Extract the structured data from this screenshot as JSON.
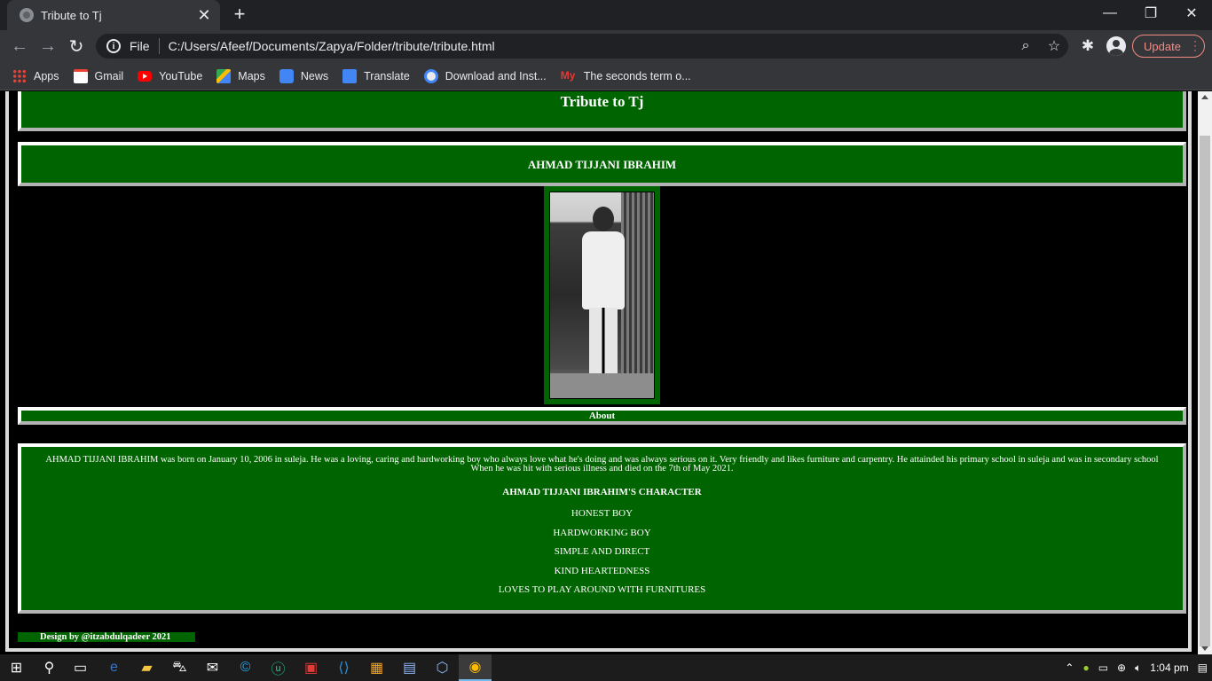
{
  "browser": {
    "tab_title": "Tribute to Tj",
    "new_tab_icon": "+",
    "close_icon": "✕",
    "window_controls": {
      "minimize": "—",
      "restore": "❐",
      "close": "✕"
    },
    "scheme_label": "File",
    "url": "C:/Users/Afeef/Documents/Zapya/Folder/tribute/tribute.html",
    "update_label": "Update"
  },
  "bookmarks": [
    {
      "label": "Apps",
      "icon": "apps-icon"
    },
    {
      "label": "Gmail",
      "icon": "gmail-icon"
    },
    {
      "label": "YouTube",
      "icon": "youtube-icon"
    },
    {
      "label": "Maps",
      "icon": "maps-icon"
    },
    {
      "label": "News",
      "icon": "news-icon"
    },
    {
      "label": "Translate",
      "icon": "translate-icon"
    },
    {
      "label": "Download and Inst...",
      "icon": "download-icon"
    },
    {
      "label": "The seconds term o...",
      "icon": "my-icon",
      "icon_text": "My"
    }
  ],
  "page": {
    "title": "Tribute to Tj",
    "name": "AHMAD TIJJANI IBRAHIM",
    "about_heading": "About",
    "bio": "AHMAD TIJJANI IBRAHIM was born on January 10, 2006 in suleja. He was a loving, caring and hardworking boy who always love what he's doing and was always serious on it. Very friendly and likes furniture and carpentry. He attainded his primary school in suleja and was in secondary school When he was hit with serious illness and died on the 7th of May 2021.",
    "character_heading": "AHMAD TIJJANI IBRAHIM'S CHARACTER",
    "traits": [
      "HONEST BOY",
      "HARDWORKING BOY",
      "SIMPLE AND DIRECT",
      "KIND HEARTEDNESS",
      "LOVES TO PLAY AROUND WITH FURNITURES"
    ],
    "footer": "Design by @itzabdulqadeer 2021"
  },
  "taskbar": {
    "clock": "1:04 pm"
  },
  "colors": {
    "page_green": "#006400",
    "page_background": "#000000",
    "update_accent": "#f28b82"
  }
}
